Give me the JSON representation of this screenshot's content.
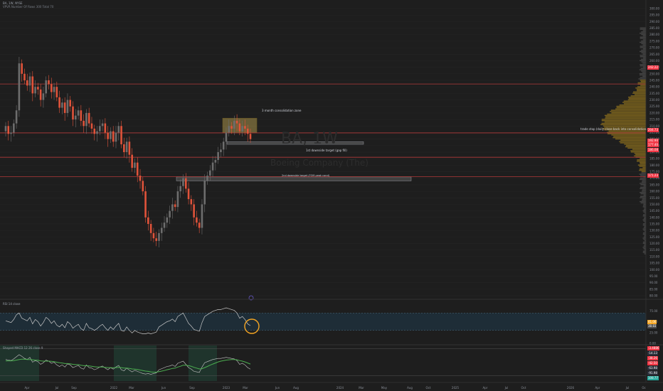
{
  "header": {
    "symbol_line": "BA, 1W, NYSE",
    "indicator_line": "VPVR Number Of Rows 300 Total 70"
  },
  "watermark": {
    "ticker": "BA, 1W",
    "company": "Boeing Company (The)"
  },
  "annotations": {
    "consolidation": "3 month consolidation zone",
    "trade_stop": "trade stop (daily close back into consolidation zone)",
    "target1": "1st downside target (gap fill)",
    "target2": "2nd downside target (FOM peak cond)"
  },
  "price_tags": [
    {
      "label": "242.22",
      "color": "#f23645"
    },
    {
      "label": "204.73",
      "color": "#f23645"
    },
    {
      "label": "192.94",
      "color": "#f23645"
    },
    {
      "label": "177.40",
      "color": "#f23645"
    },
    {
      "label": "186.08",
      "color": "#f23645"
    },
    {
      "label": "171.23",
      "color": "#f23645"
    }
  ],
  "rsi_panel": {
    "label": "RSI 14 close",
    "tags": [
      {
        "label": "41.06",
        "color": "#f6a623"
      },
      {
        "label": "38.83",
        "color": "#4a4a4a"
      }
    ]
  },
  "macd_panel": {
    "label": "Shaped MACD 12 26 close 9",
    "tags": [
      {
        "label": "-3.4886",
        "color": "#f23645"
      },
      {
        "label": "-14.13",
        "color": "#2a2e39"
      },
      {
        "label": "-38.26",
        "color": "#f23645"
      },
      {
        "label": "-42.50",
        "color": "#f23645"
      },
      {
        "label": "-63.98",
        "color": "#2a2e39"
      },
      {
        "label": "-91.98",
        "color": "#2a2e39"
      },
      {
        "label": "108.77",
        "color": "#26a69a"
      }
    ]
  },
  "x_axis": {
    "ticks": [
      "Apr",
      "Jul",
      "Sep",
      "2022",
      "Mar",
      "Jun",
      "Sep",
      "2023",
      "Mar",
      "Jun",
      "Aug",
      "2024",
      "Mar",
      "May",
      "Aug",
      "Oct",
      "2025",
      "Apr",
      "Jul",
      "Oct",
      "2026",
      "Apr",
      "Jul",
      "Oc"
    ]
  },
  "chart_data": {
    "type": "line",
    "title": "",
    "xlabel": "",
    "ylabel": "",
    "y_axis_ticks": [
      "300.00",
      "295.00",
      "290.00",
      "285.00",
      "280.00",
      "275.00",
      "270.00",
      "265.00",
      "260.00",
      "255.00",
      "250.00",
      "245.00",
      "240.00",
      "235.00",
      "230.00",
      "225.00",
      "220.00",
      "215.00",
      "210.00",
      "205.00",
      "200.00",
      "195.00",
      "190.00",
      "185.00",
      "180.00",
      "175.00",
      "170.00",
      "165.00",
      "160.00",
      "155.00",
      "150.00",
      "145.00",
      "140.00",
      "135.00",
      "130.00",
      "125.00",
      "120.00",
      "115.00",
      "110.00",
      "105.00",
      "100.00",
      "95.00",
      "90.00",
      "85.00",
      "80.00"
    ],
    "ylim": [
      80,
      300
    ],
    "horizontal_levels": [
      242.22,
      204.73,
      186.08,
      171.23
    ],
    "zones": [
      {
        "name": "3 month consolidation zone",
        "y_from": 205,
        "y_to": 213
      },
      {
        "name": "gap fill target",
        "y_from": 196,
        "y_to": 198
      },
      {
        "name": "second target",
        "y_from": 168,
        "y_to": 171
      }
    ],
    "close_weekly": [
      210,
      204,
      205,
      212,
      222,
      258,
      250,
      245,
      241,
      248,
      235,
      240,
      238,
      230,
      235,
      245,
      242,
      236,
      240,
      232,
      224,
      228,
      220,
      230,
      225,
      215,
      218,
      222,
      214,
      210,
      220,
      212,
      208,
      204,
      206,
      210,
      212,
      205,
      200,
      206,
      198,
      205,
      210,
      196,
      190,
      198,
      188,
      178,
      182,
      172,
      168,
      160,
      140,
      135,
      128,
      124,
      122,
      128,
      132,
      136,
      140,
      145,
      150,
      148,
      160,
      164,
      170,
      162,
      154,
      150,
      140,
      136,
      132,
      150,
      168,
      172,
      176,
      182,
      184,
      190,
      192,
      198,
      205,
      210,
      208,
      214,
      212,
      206,
      210,
      208,
      204,
      200
    ],
    "rsi_ylim": [
      0,
      100
    ],
    "rsi_bands": [
      30,
      70
    ],
    "rsi": [
      52,
      50,
      48,
      55,
      66,
      70,
      58,
      55,
      52,
      60,
      45,
      55,
      50,
      40,
      48,
      60,
      55,
      46,
      52,
      42,
      38,
      44,
      36,
      50,
      45,
      35,
      40,
      44,
      34,
      30,
      46,
      36,
      34,
      30,
      34,
      40,
      44,
      36,
      30,
      38,
      32,
      40,
      46,
      30,
      28,
      38,
      30,
      24,
      30,
      26,
      24,
      22,
      22,
      24,
      22,
      24,
      26,
      38,
      42,
      46,
      50,
      52,
      56,
      50,
      62,
      66,
      70,
      58,
      46,
      40,
      32,
      30,
      28,
      48,
      62,
      66,
      70,
      74,
      76,
      78,
      78,
      80,
      82,
      80,
      78,
      76,
      70,
      58,
      62,
      55,
      45,
      41
    ],
    "macd_ylim": [
      -120,
      12
    ],
    "macd": [
      -40,
      -42,
      -44,
      -38,
      -30,
      -22,
      -28,
      -36,
      -40,
      -32,
      -50,
      -44,
      -48,
      -58,
      -52,
      -42,
      -46,
      -54,
      -50,
      -60,
      -66,
      -60,
      -68,
      -56,
      -60,
      -70,
      -66,
      -62,
      -72,
      -76,
      -60,
      -70,
      -72,
      -78,
      -74,
      -68,
      -64,
      -72,
      -78,
      -70,
      -76,
      -68,
      -62,
      -78,
      -82,
      -72,
      -80,
      -86,
      -80,
      -84,
      -88,
      -92,
      -94,
      -92,
      -95,
      -92,
      -90,
      -78,
      -74,
      -70,
      -66,
      -64,
      -60,
      -66,
      -54,
      -50,
      -46,
      -58,
      -70,
      -76,
      -84,
      -86,
      -88,
      -68,
      -52,
      -48,
      -44,
      -40,
      -38,
      -36,
      -36,
      -34,
      -32,
      -34,
      -36,
      -38,
      -44,
      -58,
      -54,
      -60,
      -70,
      -76
    ],
    "macd_signal": [
      -45,
      -45,
      -45,
      -44,
      -42,
      -40,
      -39,
      -39,
      -40,
      -40,
      -41,
      -42,
      -43,
      -45,
      -46,
      -46,
      -46,
      -47,
      -48,
      -50,
      -52,
      -53,
      -55,
      -55,
      -56,
      -58,
      -59,
      -59,
      -61,
      -63,
      -63,
      -64,
      -65,
      -67,
      -68,
      -68,
      -68,
      -69,
      -70,
      -70,
      -71,
      -70,
      -69,
      -70,
      -72,
      -72,
      -73,
      -75,
      -76,
      -77,
      -79,
      -81,
      -83,
      -84,
      -86,
      -87,
      -87,
      -85,
      -83,
      -81,
      -78,
      -76,
      -73,
      -72,
      -68,
      -65,
      -61,
      -61,
      -63,
      -65,
      -69,
      -72,
      -75,
      -74,
      -70,
      -66,
      -61,
      -57,
      -53,
      -49,
      -46,
      -44,
      -42,
      -41,
      -40,
      -40,
      -41,
      -44,
      -46,
      -49,
      -53,
      -57
    ]
  }
}
